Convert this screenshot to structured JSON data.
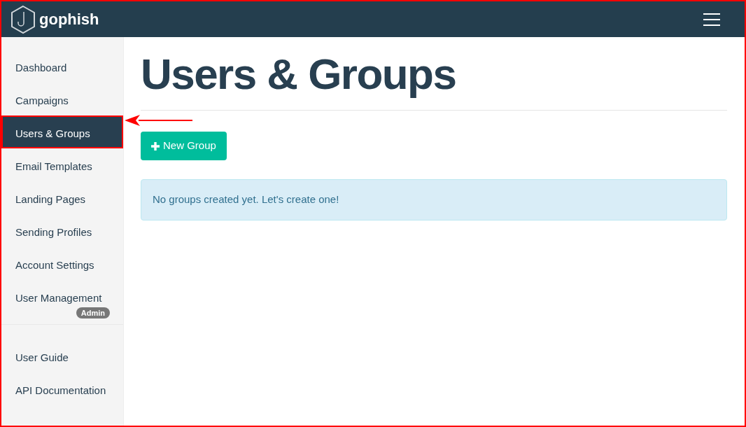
{
  "navbar": {
    "brand": "gophish"
  },
  "sidebar": {
    "sections": [
      {
        "items": [
          {
            "label": "Dashboard",
            "selected": false,
            "highlighted": false
          },
          {
            "label": "Campaigns",
            "selected": false,
            "highlighted": false
          },
          {
            "label": "Users & Groups",
            "selected": true,
            "highlighted": true
          },
          {
            "label": "Email Templates",
            "selected": false,
            "highlighted": false
          },
          {
            "label": "Landing Pages",
            "selected": false,
            "highlighted": false
          },
          {
            "label": "Sending Profiles",
            "selected": false,
            "highlighted": false
          },
          {
            "label": "Account Settings",
            "selected": false,
            "highlighted": false
          },
          {
            "label": "User Management",
            "selected": false,
            "highlighted": false,
            "badge": "Admin"
          }
        ]
      },
      {
        "items": [
          {
            "label": "User Guide",
            "selected": false,
            "highlighted": false
          },
          {
            "label": "API Documentation",
            "selected": false,
            "highlighted": false
          }
        ]
      }
    ]
  },
  "main": {
    "title": "Users & Groups",
    "new_button": "New Group",
    "alert": "No groups created yet. Let's create one!"
  }
}
